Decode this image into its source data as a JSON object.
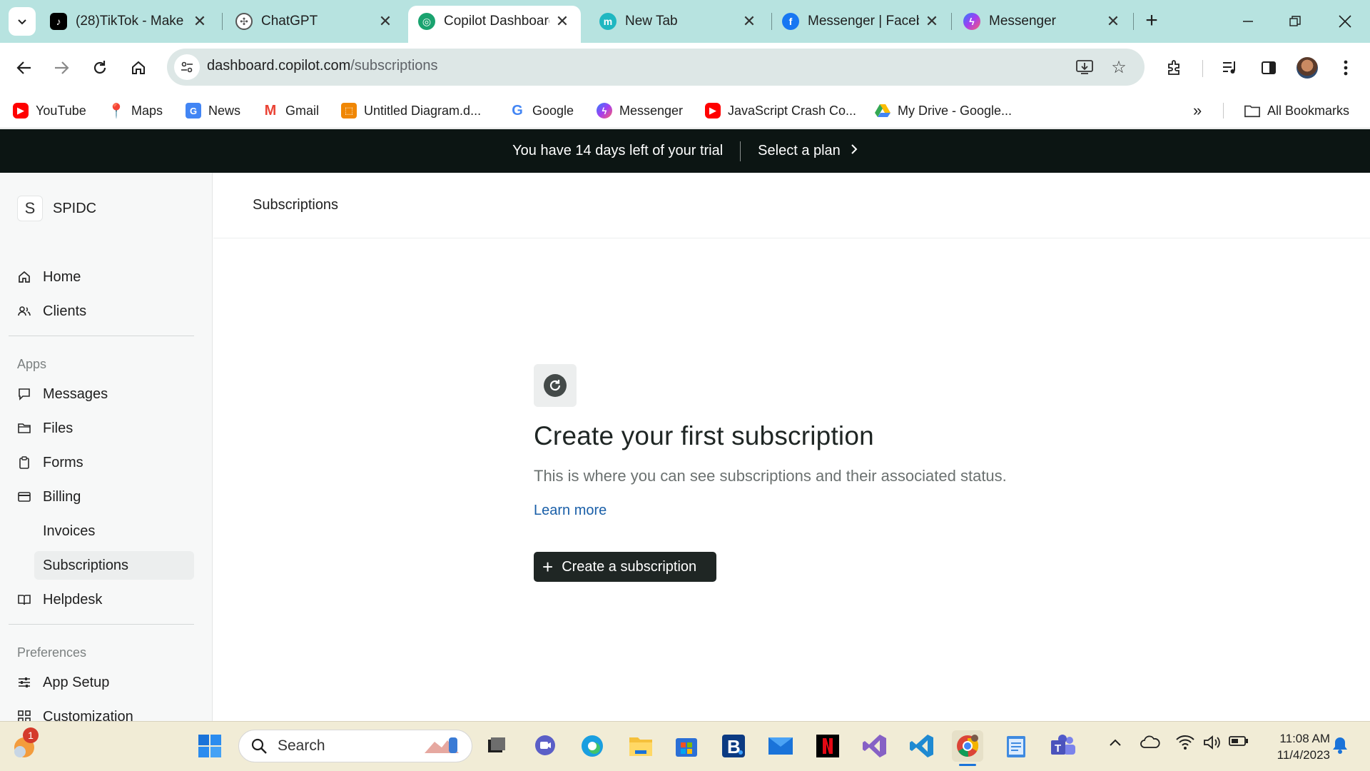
{
  "browser": {
    "tabs": [
      {
        "title": "(28)TikTok - Make",
        "icon": "tiktok-icon",
        "active": false
      },
      {
        "title": "ChatGPT",
        "icon": "chatgpt-icon",
        "active": false
      },
      {
        "title": "Copilot Dashboard",
        "icon": "copilot-icon",
        "active": true
      },
      {
        "title": "New Tab",
        "icon": "new-tab-favicon",
        "active": false
      },
      {
        "title": "Messenger | Faceb",
        "icon": "facebook-icon",
        "active": false
      },
      {
        "title": "Messenger",
        "icon": "messenger-icon",
        "active": false
      }
    ],
    "url_host": "dashboard.copilot.com",
    "url_path": "/subscriptions",
    "bookmarks": [
      {
        "label": "YouTube",
        "icon": "youtube-icon"
      },
      {
        "label": "Maps",
        "icon": "maps-icon"
      },
      {
        "label": "News",
        "icon": "news-icon"
      },
      {
        "label": "Gmail",
        "icon": "gmail-icon"
      },
      {
        "label": "Untitled Diagram.d...",
        "icon": "drawio-icon"
      },
      {
        "label": "Google",
        "icon": "google-icon"
      },
      {
        "label": "Messenger",
        "icon": "messenger-icon"
      },
      {
        "label": "JavaScript Crash Co...",
        "icon": "youtube-icon"
      },
      {
        "label": "My Drive - Google...",
        "icon": "drive-icon"
      }
    ],
    "all_bookmarks": "All Bookmarks"
  },
  "banner": {
    "message": "You have 14 days left of your trial",
    "action": "Select a plan"
  },
  "sidebar": {
    "workspace_initial": "S",
    "workspace_name": "SPIDC",
    "primary": [
      {
        "label": "Home",
        "icon": "home-icon"
      },
      {
        "label": "Clients",
        "icon": "clients-icon"
      }
    ],
    "apps_label": "Apps",
    "apps": [
      {
        "label": "Messages",
        "icon": "message-icon"
      },
      {
        "label": "Files",
        "icon": "folder-icon"
      },
      {
        "label": "Forms",
        "icon": "clipboard-icon"
      },
      {
        "label": "Billing",
        "icon": "card-icon"
      },
      {
        "label": "Invoices",
        "sub": true
      },
      {
        "label": "Subscriptions",
        "sub": true,
        "active": true
      },
      {
        "label": "Helpdesk",
        "icon": "book-icon"
      }
    ],
    "preferences_label": "Preferences",
    "preferences": [
      {
        "label": "App Setup",
        "icon": "sliders-icon"
      },
      {
        "label": "Customization",
        "icon": "grid-icon"
      }
    ]
  },
  "main": {
    "page_title": "Subscriptions",
    "empty_title": "Create your first subscription",
    "empty_desc": "This is where you can see subscriptions and their associated status.",
    "learn_more": "Learn more",
    "cta": "Create a subscription"
  },
  "taskbar": {
    "search_label": "Search",
    "weather_badge": "1",
    "time": "11:08 AM",
    "date": "11/4/2023"
  },
  "colors": {
    "tabstrip": "#b7e3e0",
    "banner": "#0c1513",
    "cta": "#1f2624",
    "link": "#1a5fa8",
    "sidebar": "#f7f8f8"
  }
}
